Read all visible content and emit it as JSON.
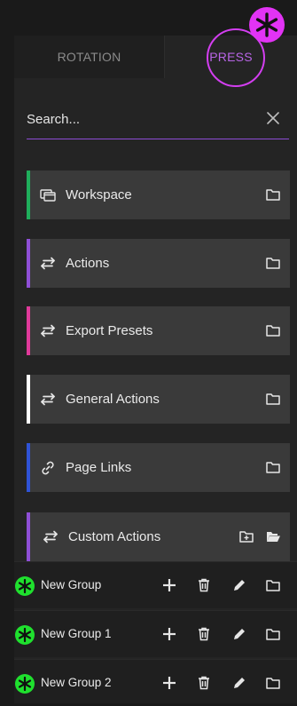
{
  "tabs": [
    {
      "label": "ROTATION"
    },
    {
      "label": "PRESS"
    }
  ],
  "search": {
    "placeholder": "Search..."
  },
  "items": [
    {
      "label": "Workspace",
      "icon": "windows-icon",
      "accent": "#1fae5b"
    },
    {
      "label": "Actions",
      "icon": "swap-arrows-icon",
      "accent": "#8f4fd6"
    },
    {
      "label": "Export Presets",
      "icon": "swap-arrows-icon",
      "accent": "#e03a9a"
    },
    {
      "label": "General Actions",
      "icon": "swap-arrows-icon",
      "accent": "#ffffff"
    },
    {
      "label": "Page Links",
      "icon": "link-icon",
      "accent": "#2f53d6"
    },
    {
      "label": "Custom Actions",
      "icon": "swap-arrows-icon",
      "accent": "#8f4fd6"
    }
  ],
  "groups": [
    {
      "label": "New Group"
    },
    {
      "label": "New Group 1"
    },
    {
      "label": "New Group 2"
    }
  ],
  "colors": {
    "accent": "#8f4fd6",
    "badge_press": "#e233f5",
    "badge_group": "#1fe02e"
  }
}
